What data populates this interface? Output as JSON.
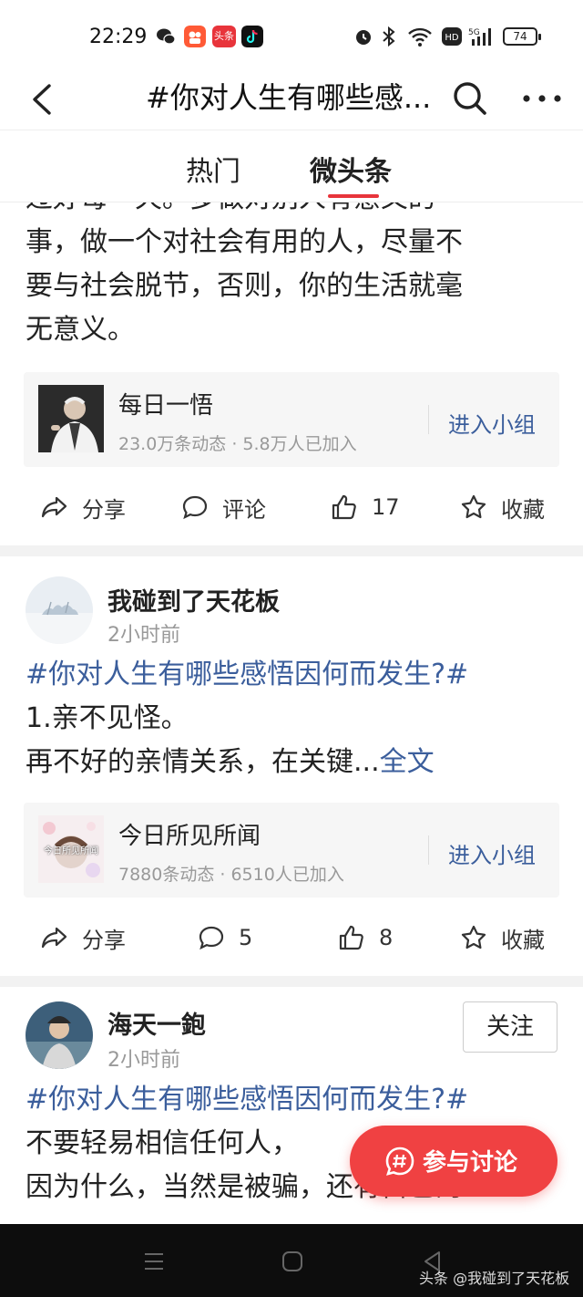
{
  "status_bar": {
    "time": "22:29",
    "apps": [
      "wechat-icon",
      "kuaishou-icon",
      "toutiao-icon",
      "douyin-icon"
    ],
    "toutiao_label": "头条",
    "battery": "74",
    "indicators": [
      "alarm-icon",
      "bluetooth-icon",
      "wifi-icon",
      "hd-icon",
      "5g-signal-icon"
    ]
  },
  "header": {
    "title": "#你对人生有哪些感...",
    "back_icon": "chevron-left-icon",
    "search_icon": "search-icon",
    "more_icon": "more-dots-icon"
  },
  "tabs": [
    {
      "label": "热门",
      "active": false
    },
    {
      "label": "微头条",
      "active": true
    }
  ],
  "posts": [
    {
      "text_lines": [
        "过好每一天。多做对别人有意义的",
        "事，做一个对社会有用的人，尽量不",
        "要与社会脱节，否则，你的生活就毫",
        "无意义。"
      ],
      "group": {
        "name": "每日一悟",
        "stats": "23.0万条动态 · 5.8万人已加入",
        "join": "进入小组"
      },
      "actions": {
        "share": "分享",
        "comment": "评论",
        "like": "17",
        "favorite": "收藏"
      }
    },
    {
      "author": "我碰到了天花板",
      "time": "2小时前",
      "hashtag": "#你对人生有哪些感悟因何而发生?#",
      "lines": [
        "1.亲不见怪。"
      ],
      "truncated_line": "再不好的亲情关系，在关键...",
      "more_link": "全文",
      "group": {
        "name": "今日所见所闻",
        "stats": "7880条动态 · 6510人已加入",
        "join": "进入小组",
        "avatar_text": "今日所见所闻"
      },
      "actions": {
        "share": "分享",
        "comment": "5",
        "like": "8",
        "favorite": "收藏"
      }
    },
    {
      "author": "海天一鉋",
      "time": "2小时前",
      "follow": "关注",
      "hashtag": "#你对人生有哪些感悟因何而发生?#",
      "lines": [
        "不要轻易相信任何人，",
        "因为什么，当然是被骗，还有自己的"
      ]
    }
  ],
  "fab": {
    "label": "参与讨论",
    "icon": "hash-chat-icon"
  },
  "footer": {
    "watermark": "头条 @我碰到了天花板"
  },
  "colors": {
    "accent": "#f04142",
    "link": "#3b5e9c",
    "tab_underline": "#e8343b"
  }
}
